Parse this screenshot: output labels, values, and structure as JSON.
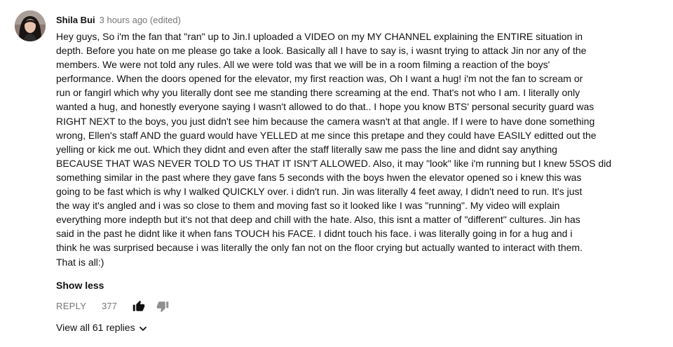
{
  "comment": {
    "author": "Shila Bui",
    "time": "3 hours ago (edited)",
    "lines": [
      "Hey guys, So i'm the fan that \"ran\" up to Jin.I uploaded a VIDEO on my MY CHANNEL explaining the ENTIRE situation in",
      "depth. Before you hate on me please go take a look. Basically all I have to say is, i wasnt trying to attack Jin nor any of the",
      "members. We were not told any rules. All we were told was that we will be in a room filming a reaction of the boys'",
      "performance. When the doors opened for the elevator, my first reaction was, Oh I want a hug! i'm not the fan to scream or",
      "run or fangirl which why you literally dont see me standing there screaming at the end. That's not who I am. I literally only",
      "wanted a hug, and honestly everyone saying I wasn't allowed to do that.. I hope you know BTS' personal security guard was",
      "RIGHT NEXT to the boys, you just didn't see him because the camera wasn't at that angle. If I were to have done something",
      "wrong, Ellen's staff AND the guard would have YELLED at me since this pretape and they could have EASILY editted out the",
      "yelling or kick me out. Which they didnt and even after the staff literally saw me pass the line and didnt say anything",
      "BECAUSE THAT WAS NEVER TOLD TO US THAT IT ISN'T ALLOWED. Also, it may \"look\" like i'm running but I knew 5SOS did",
      "something similar in the past where they gave fans 5 seconds with the boys hwen the elevator opened so i knew this was",
      "going to be fast which is why I walked QUICKLY over. i didn't run. Jin was literally 4 feet away, I didn't need to run. It's just",
      "the way it's angled and i was so close to them and moving fast so it looked like I was \"running\". My video will explain",
      "everything more indepth but it's not that deep and chill with the hate. Also, this isnt a matter of \"different\" cultures. Jin has",
      "said in the past he didnt like it when fans TOUCH his FACE. I didnt touch his face. i was literally going in for a hug and i",
      "think he was surprised because i was literally the only fan not on the floor crying but actually wanted to interact with them.",
      "That is all:)"
    ],
    "show_less_label": "Show less",
    "reply_label": "REPLY",
    "like_count": "377",
    "view_replies_label": "View all 61 replies"
  },
  "icons": {
    "avatar": "avatar",
    "like": "thumb-up-icon",
    "dislike": "thumb-down-icon",
    "expand": "chevron-down-icon"
  },
  "colors": {
    "text": "#111111",
    "secondary": "#767676",
    "dislike_icon": "#909090"
  }
}
